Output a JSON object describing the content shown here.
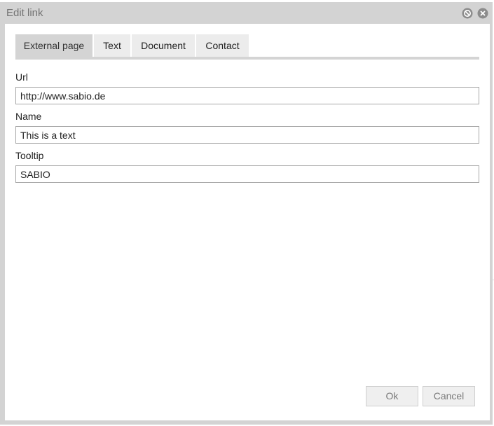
{
  "dialog": {
    "title": "Edit link",
    "title_buttons": [
      "help-icon",
      "close-icon"
    ]
  },
  "tabs": [
    {
      "label": "External page",
      "active": true
    },
    {
      "label": "Text",
      "active": false
    },
    {
      "label": "Document",
      "active": false
    },
    {
      "label": "Contact",
      "active": false
    }
  ],
  "form": {
    "url": {
      "label": "Url",
      "value": "http://www.sabio.de"
    },
    "name": {
      "label": "Name",
      "value": "This is a text"
    },
    "tooltip": {
      "label": "Tooltip",
      "value": "SABIO"
    }
  },
  "buttons": {
    "ok": "Ok",
    "cancel": "Cancel"
  },
  "colors": {
    "titlebar": "#d3d3d3",
    "active_tab": "#d4d4d4",
    "inactive_tab": "#ececec",
    "button_text": "#7a7a7a"
  }
}
